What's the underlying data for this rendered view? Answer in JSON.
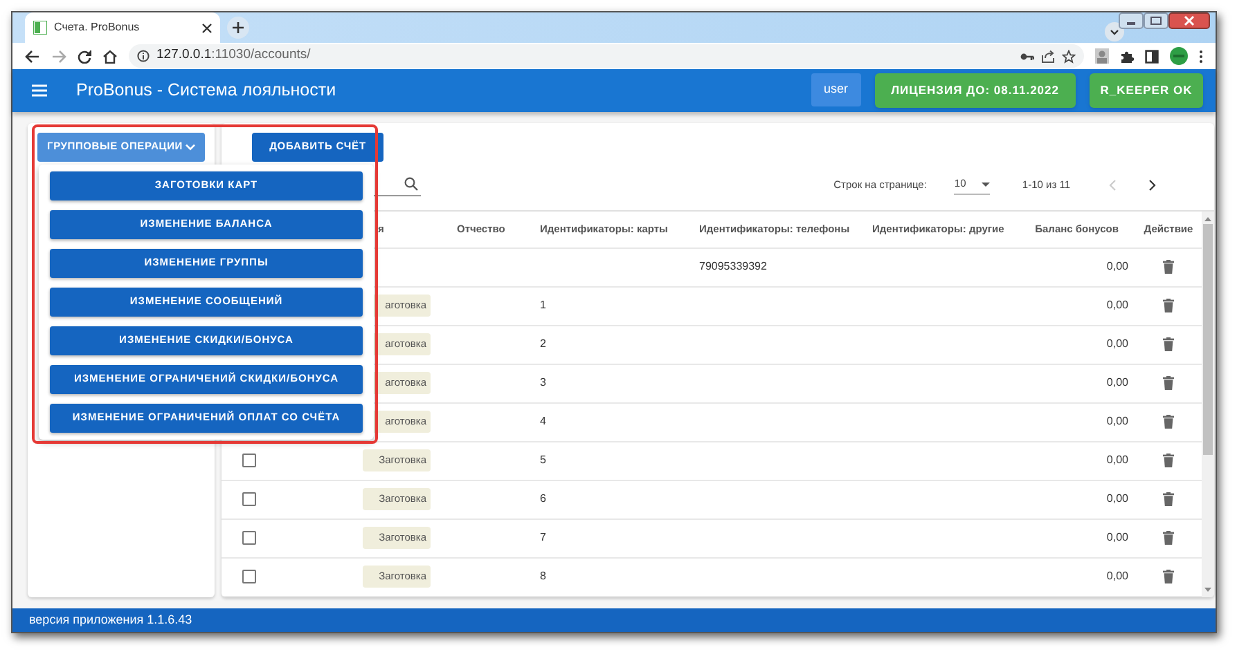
{
  "browser": {
    "tab": {
      "title": "Счета. ProBonus"
    },
    "url_host": "127.0.0.1",
    "url_rest": ":11030/accounts/"
  },
  "app_bar": {
    "title": "ProBonus - Система лояльности",
    "user": "user",
    "license": "ЛИЦЕНЗИЯ ДО: 08.11.2022",
    "status": "R_KEEPER OK"
  },
  "toolbar": {
    "group_operations": "ГРУППОВЫЕ ОПЕРАЦИИ",
    "add_account": "ДОБАВИТЬ СЧЁТ"
  },
  "group_menu": {
    "items": [
      "ЗАГОТОВКИ КАРТ",
      "ИЗМЕНЕНИЕ БАЛАНСА",
      "ИЗМЕНЕНИЕ ГРУППЫ",
      "ИЗМЕНЕНИЕ СООБЩЕНИЙ",
      "ИЗМЕНЕНИЕ СКИДКИ/БОНУСА",
      "ИЗМЕНЕНИЕ ОГРАНИЧЕНИЙ СКИДКИ/БОНУСА",
      "ИЗМЕНЕНИЕ ОГРАНИЧЕНИЙ ОПЛАТ СО СЧЁТА"
    ]
  },
  "pagination": {
    "rows_label": "Строк на странице:",
    "rows_value": "10",
    "range": "1-10 из 11",
    "prev_disabled": true,
    "next_disabled": false
  },
  "table": {
    "columns": [
      "я",
      "Отчество",
      "Идентификаторы: карты",
      "Идентификаторы: телефоны",
      "Идентификаторы: другие",
      "Баланс бонусов",
      "Действие"
    ],
    "rows": [
      {
        "phone": "79095339392",
        "balance": "0,00"
      },
      {
        "tag": "аготовка",
        "card": "1",
        "balance": "0,00"
      },
      {
        "tag": "аготовка",
        "card": "2",
        "balance": "0,00"
      },
      {
        "tag": "аготовка",
        "card": "3",
        "balance": "0,00"
      },
      {
        "tag": "аготовка",
        "card": "4",
        "balance": "0,00"
      },
      {
        "checked": false,
        "tag": "Заготовка",
        "card": "5",
        "balance": "0,00"
      },
      {
        "checked": false,
        "tag": "Заготовка",
        "card": "6",
        "balance": "0,00"
      },
      {
        "checked": false,
        "tag": "Заготовка",
        "card": "7",
        "balance": "0,00"
      },
      {
        "checked": false,
        "tag": "Заготовка",
        "card": "8",
        "balance": "0,00"
      }
    ]
  },
  "footer": {
    "version": "версия приложения 1.1.6.43"
  }
}
